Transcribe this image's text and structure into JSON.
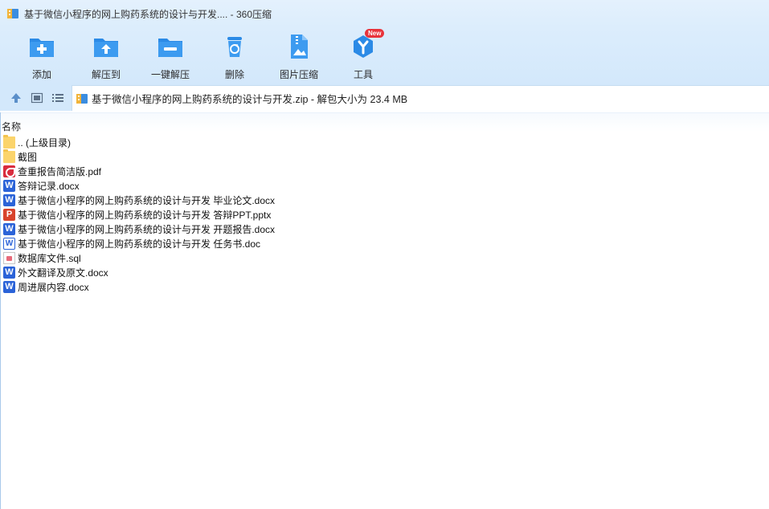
{
  "window": {
    "title": "基于微信小程序的网上购药系统的设计与开发.... - 360压缩"
  },
  "toolbar": {
    "items": [
      {
        "label": "添加",
        "icon": "add-folder-icon"
      },
      {
        "label": "解压到",
        "icon": "extract-to-icon"
      },
      {
        "label": "一键解压",
        "icon": "one-click-extract-icon"
      },
      {
        "label": "删除",
        "icon": "delete-icon"
      },
      {
        "label": "图片压缩",
        "icon": "image-compress-icon"
      },
      {
        "label": "工具",
        "icon": "tools-icon",
        "badge": "New"
      }
    ]
  },
  "address": {
    "path": "基于微信小程序的网上购药系统的设计与开发.zip - 解包大小为 23.4 MB"
  },
  "list": {
    "header": "名称",
    "files": [
      {
        "name": ".. (上级目录)",
        "icon": "folder-icon"
      },
      {
        "name": "截图",
        "icon": "folder-icon"
      },
      {
        "name": "查重报告简洁版.pdf",
        "icon": "pdf-icon"
      },
      {
        "name": "答辩记录.docx",
        "icon": "word-icon"
      },
      {
        "name": "基于微信小程序的网上购药系统的设计与开发 毕业论文.docx",
        "icon": "word-icon"
      },
      {
        "name": "基于微信小程序的网上购药系统的设计与开发 答辩PPT.pptx",
        "icon": "ppt-icon"
      },
      {
        "name": "基于微信小程序的网上购药系统的设计与开发 开题报告.docx",
        "icon": "word-icon"
      },
      {
        "name": "基于微信小程序的网上购药系统的设计与开发 任务书.doc",
        "icon": "word-doc-icon"
      },
      {
        "name": "数据库文件.sql",
        "icon": "sql-icon"
      },
      {
        "name": "外文翻译及原文.docx",
        "icon": "word-icon"
      },
      {
        "name": "周进展内容.docx",
        "icon": "word-icon"
      }
    ]
  },
  "colors": {
    "toolbar_bg": "#dcedfc",
    "icon_blue": "#2b8ae6",
    "badge_red": "#e8333b"
  }
}
